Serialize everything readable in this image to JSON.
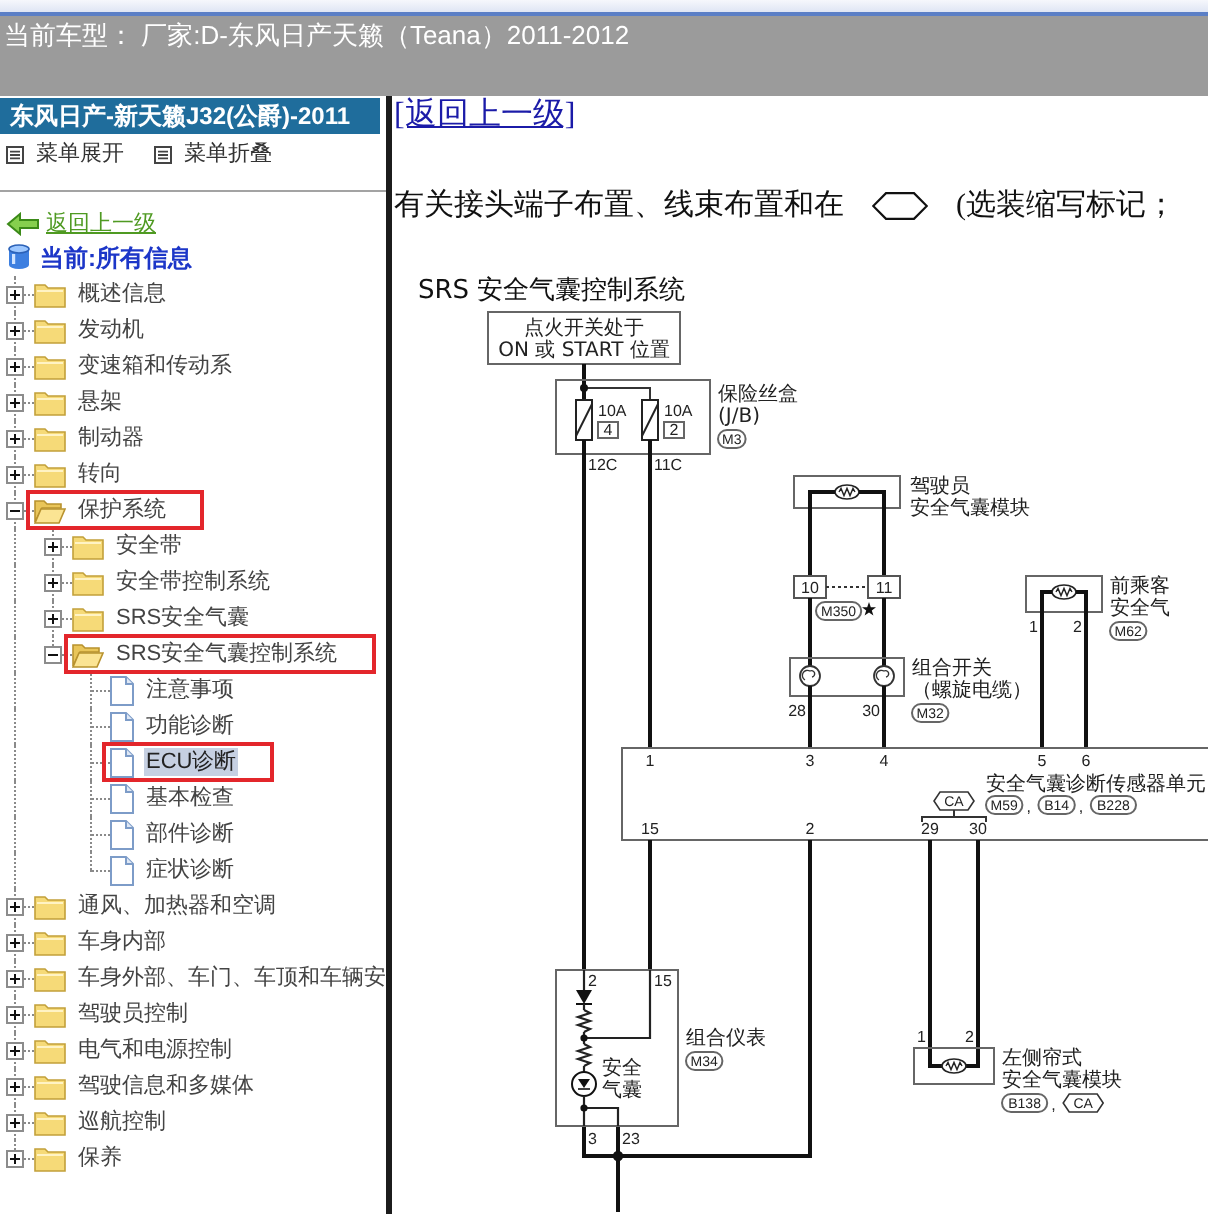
{
  "top_bar": {
    "current_model": "当前车型： 厂家:D-东风日产天籁（Teana）2011-2012"
  },
  "sidebar": {
    "vehicle": "东风日产-新天籁J32(公爵)-2011",
    "menu_actions": [
      "菜单展开",
      "菜单折叠"
    ],
    "back_link": "返回上一级",
    "current": "当前:所有信息",
    "tree": [
      {
        "label": "概述信息",
        "kind": "folder",
        "expanded": false,
        "selected": false,
        "annotated": false
      },
      {
        "label": "发动机",
        "kind": "folder",
        "expanded": false,
        "selected": false,
        "annotated": false
      },
      {
        "label": "变速箱和传动系",
        "kind": "folder",
        "expanded": false,
        "selected": false,
        "annotated": false
      },
      {
        "label": "悬架",
        "kind": "folder",
        "expanded": false,
        "selected": false,
        "annotated": false
      },
      {
        "label": "制动器",
        "kind": "folder",
        "expanded": false,
        "selected": false,
        "annotated": false
      },
      {
        "label": "转向",
        "kind": "folder",
        "expanded": false,
        "selected": false,
        "annotated": false
      },
      {
        "label": "保护系统",
        "kind": "folder",
        "expanded": true,
        "selected": false,
        "annotated": true,
        "children": [
          {
            "label": "安全带",
            "kind": "folder",
            "expanded": false,
            "selected": false,
            "annotated": false
          },
          {
            "label": "安全带控制系统",
            "kind": "folder",
            "expanded": false,
            "selected": false,
            "annotated": false
          },
          {
            "label": "SRS安全气囊",
            "kind": "folder",
            "expanded": false,
            "selected": false,
            "annotated": false
          },
          {
            "label": "SRS安全气囊控制系统",
            "kind": "folder",
            "expanded": true,
            "selected": false,
            "annotated": true,
            "children": [
              {
                "label": "注意事项",
                "kind": "page",
                "selected": false,
                "annotated": false
              },
              {
                "label": "功能诊断",
                "kind": "page",
                "selected": false,
                "annotated": false
              },
              {
                "label": "ECU诊断",
                "kind": "page",
                "selected": true,
                "annotated": true
              },
              {
                "label": "基本检查",
                "kind": "page",
                "selected": false,
                "annotated": false
              },
              {
                "label": "部件诊断",
                "kind": "page",
                "selected": false,
                "annotated": false
              },
              {
                "label": "症状诊断",
                "kind": "page",
                "selected": false,
                "annotated": false
              }
            ]
          }
        ]
      },
      {
        "label": "通风、加热器和空调",
        "kind": "folder",
        "expanded": false,
        "selected": false,
        "annotated": false
      },
      {
        "label": "车身内部",
        "kind": "folder",
        "expanded": false,
        "selected": false,
        "annotated": false
      },
      {
        "label": "车身外部、车门、车顶和车辆安",
        "kind": "folder",
        "expanded": false,
        "selected": false,
        "annotated": false
      },
      {
        "label": "驾驶员控制",
        "kind": "folder",
        "expanded": false,
        "selected": false,
        "annotated": false
      },
      {
        "label": "电气和电源控制",
        "kind": "folder",
        "expanded": false,
        "selected": false,
        "annotated": false
      },
      {
        "label": "驾驶信息和多媒体",
        "kind": "folder",
        "expanded": false,
        "selected": false,
        "annotated": false
      },
      {
        "label": "巡航控制",
        "kind": "folder",
        "expanded": false,
        "selected": false,
        "annotated": false
      },
      {
        "label": "保养",
        "kind": "folder",
        "expanded": false,
        "selected": false,
        "annotated": false
      }
    ]
  },
  "content": {
    "back_link": "[返回上一级]",
    "note": {
      "before": "有关接头端子布置、线束布置和在",
      "after": "(选装缩写标记；"
    },
    "diagram": {
      "title": "SRS 安全气囊控制系统",
      "ignition": [
        "点火开关处于",
        "ON 或 START 位置"
      ],
      "fuse_box": {
        "label": [
          "保险丝盒",
          "(J/B)"
        ],
        "connector": "M3",
        "fuses": [
          {
            "rating": "10A",
            "number": "4",
            "terminal": "12C"
          },
          {
            "rating": "10A",
            "number": "2",
            "terminal": "11C"
          }
        ]
      },
      "driver_module": {
        "label": [
          "驾驶员",
          "安全气囊模块"
        ]
      },
      "harness_connector": {
        "pins": [
          "10",
          "11"
        ],
        "connector": "M350"
      },
      "spiral_cable": {
        "label": [
          "组合开关",
          "（螺旋电缆）"
        ],
        "connector": "M32",
        "pins": [
          "28",
          "30"
        ]
      },
      "passenger_module": {
        "label": [
          "前乘客",
          "安全气"
        ],
        "connector": "M62",
        "pins": [
          "1",
          "2"
        ]
      },
      "control_unit": {
        "label": "安全气囊诊断传感器单元",
        "connectors": [
          {
            "code": "M59",
            "separator": ","
          },
          {
            "code": "B14",
            "separator": ","
          },
          {
            "code": "B228"
          }
        ],
        "top_pins": [
          "1",
          "3",
          "4",
          "5",
          "6"
        ],
        "bottom_pins": [
          "15",
          "2",
          "29",
          "30"
        ],
        "option": "CA"
      },
      "combination_meter": {
        "label": "组合仪表",
        "connector": "M34",
        "top_pins": [
          "2",
          "15"
        ],
        "bottom_pins": [
          "3",
          "23"
        ],
        "lamp_label": [
          "安全",
          "气囊"
        ]
      },
      "curtain_module": {
        "label": [
          "左侧帘式",
          "安全气囊模块"
        ],
        "connector": "B138",
        "separator": ",",
        "option": "CA",
        "pins": [
          "1",
          "2"
        ]
      }
    }
  }
}
